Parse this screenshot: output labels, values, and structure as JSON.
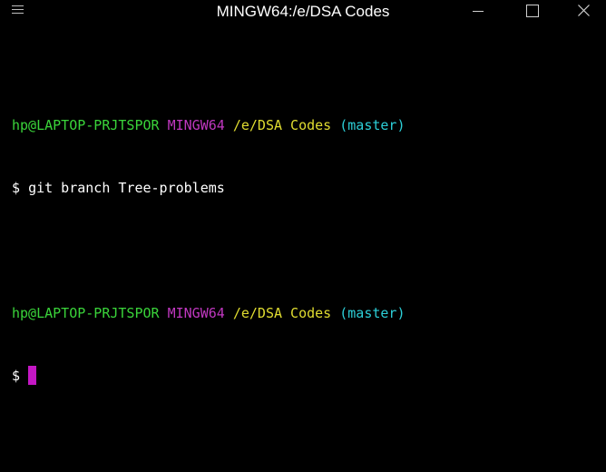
{
  "window": {
    "title": "MINGW64:/e/DSA Codes",
    "icons": {
      "menu": "hamburger-menu-icon",
      "minimize": "minimize-icon",
      "maximize": "maximize-icon",
      "close": "close-icon"
    }
  },
  "terminal": {
    "prompts": [
      {
        "user_host": "hp@LAPTOP-PRJTSPOR",
        "system": "MINGW64",
        "path": "/e/DSA Codes",
        "branch": "(master)",
        "symbol": "$",
        "command": "git branch Tree-problems"
      },
      {
        "user_host": "hp@LAPTOP-PRJTSPOR",
        "system": "MINGW64",
        "path": "/e/DSA Codes",
        "branch": "(master)",
        "symbol": "$",
        "command": ""
      }
    ]
  },
  "colors": {
    "background": "#000000",
    "user_host": "#3ad43a",
    "system": "#c038c0",
    "path": "#e0dc30",
    "branch": "#2ccfd8",
    "cursor": "#c417c4"
  }
}
